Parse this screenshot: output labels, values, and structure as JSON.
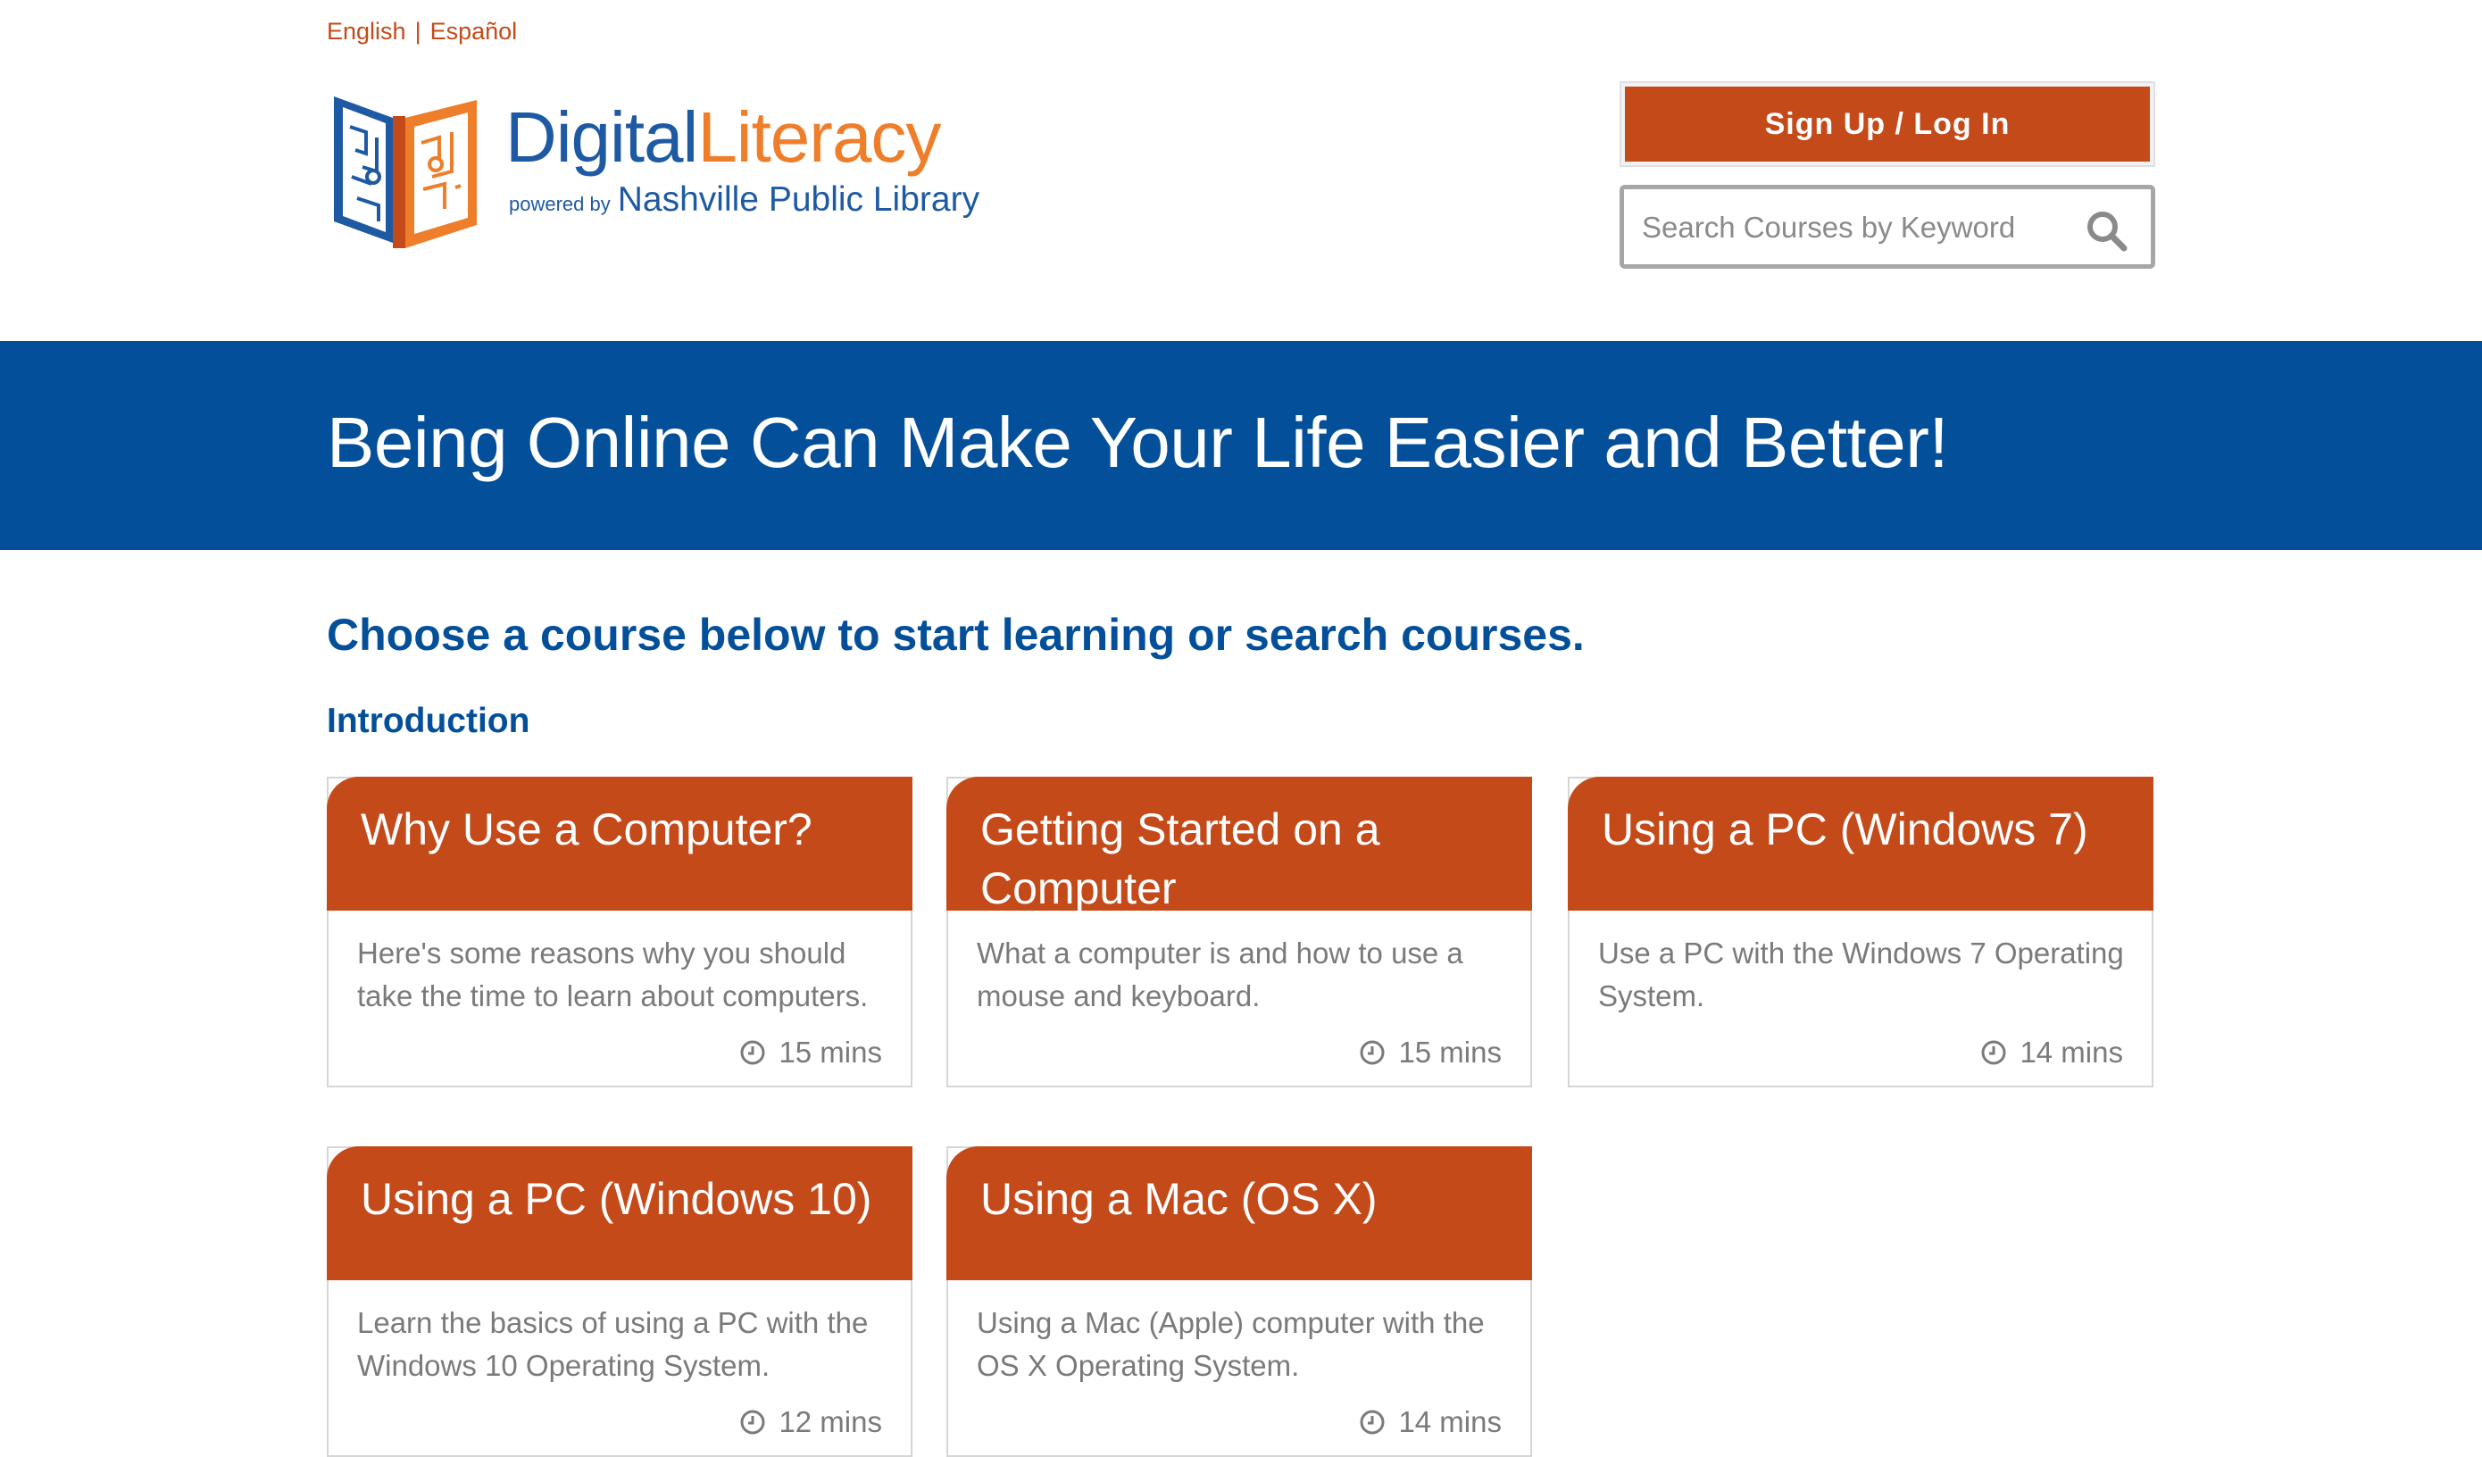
{
  "language_bar": {
    "english": "English",
    "separator": "|",
    "spanish": "Español"
  },
  "logo": {
    "digital": "Digital",
    "literacy": "Literacy",
    "powered_by": "powered by",
    "library": "Nashville Public Library"
  },
  "header": {
    "signup_label": "Sign Up / Log In",
    "search_placeholder": "Search Courses by Keyword"
  },
  "hero": {
    "title": "Being Online Can Make Your Life Easier and Better!"
  },
  "main": {
    "intro": "Choose a course below to start learning or search courses.",
    "section_title": "Introduction",
    "courses": [
      {
        "title": "Why Use a Computer?",
        "description": "Here's some reasons why you should take the time to learn about computers.",
        "duration": "15 mins"
      },
      {
        "title": "Getting Started on a Computer",
        "description": "What a computer is and how to use a mouse and keyboard.",
        "duration": "15 mins"
      },
      {
        "title": "Using a PC (Windows 7)",
        "description": "Use a PC with the Windows 7 Operating System.",
        "duration": "14 mins"
      },
      {
        "title": "Using a PC (Windows 10)",
        "description": "Learn the basics of using a PC with the Windows 10 Operating System.",
        "duration": "12 mins"
      },
      {
        "title": "Using a Mac (OS X)",
        "description": "Using a Mac (Apple) computer with the OS X Operating System.",
        "duration": "14 mins"
      }
    ]
  },
  "colors": {
    "brand_blue": "#034f99",
    "accent_orange": "#c44a1a",
    "logo_orange": "#ef7e2b"
  }
}
